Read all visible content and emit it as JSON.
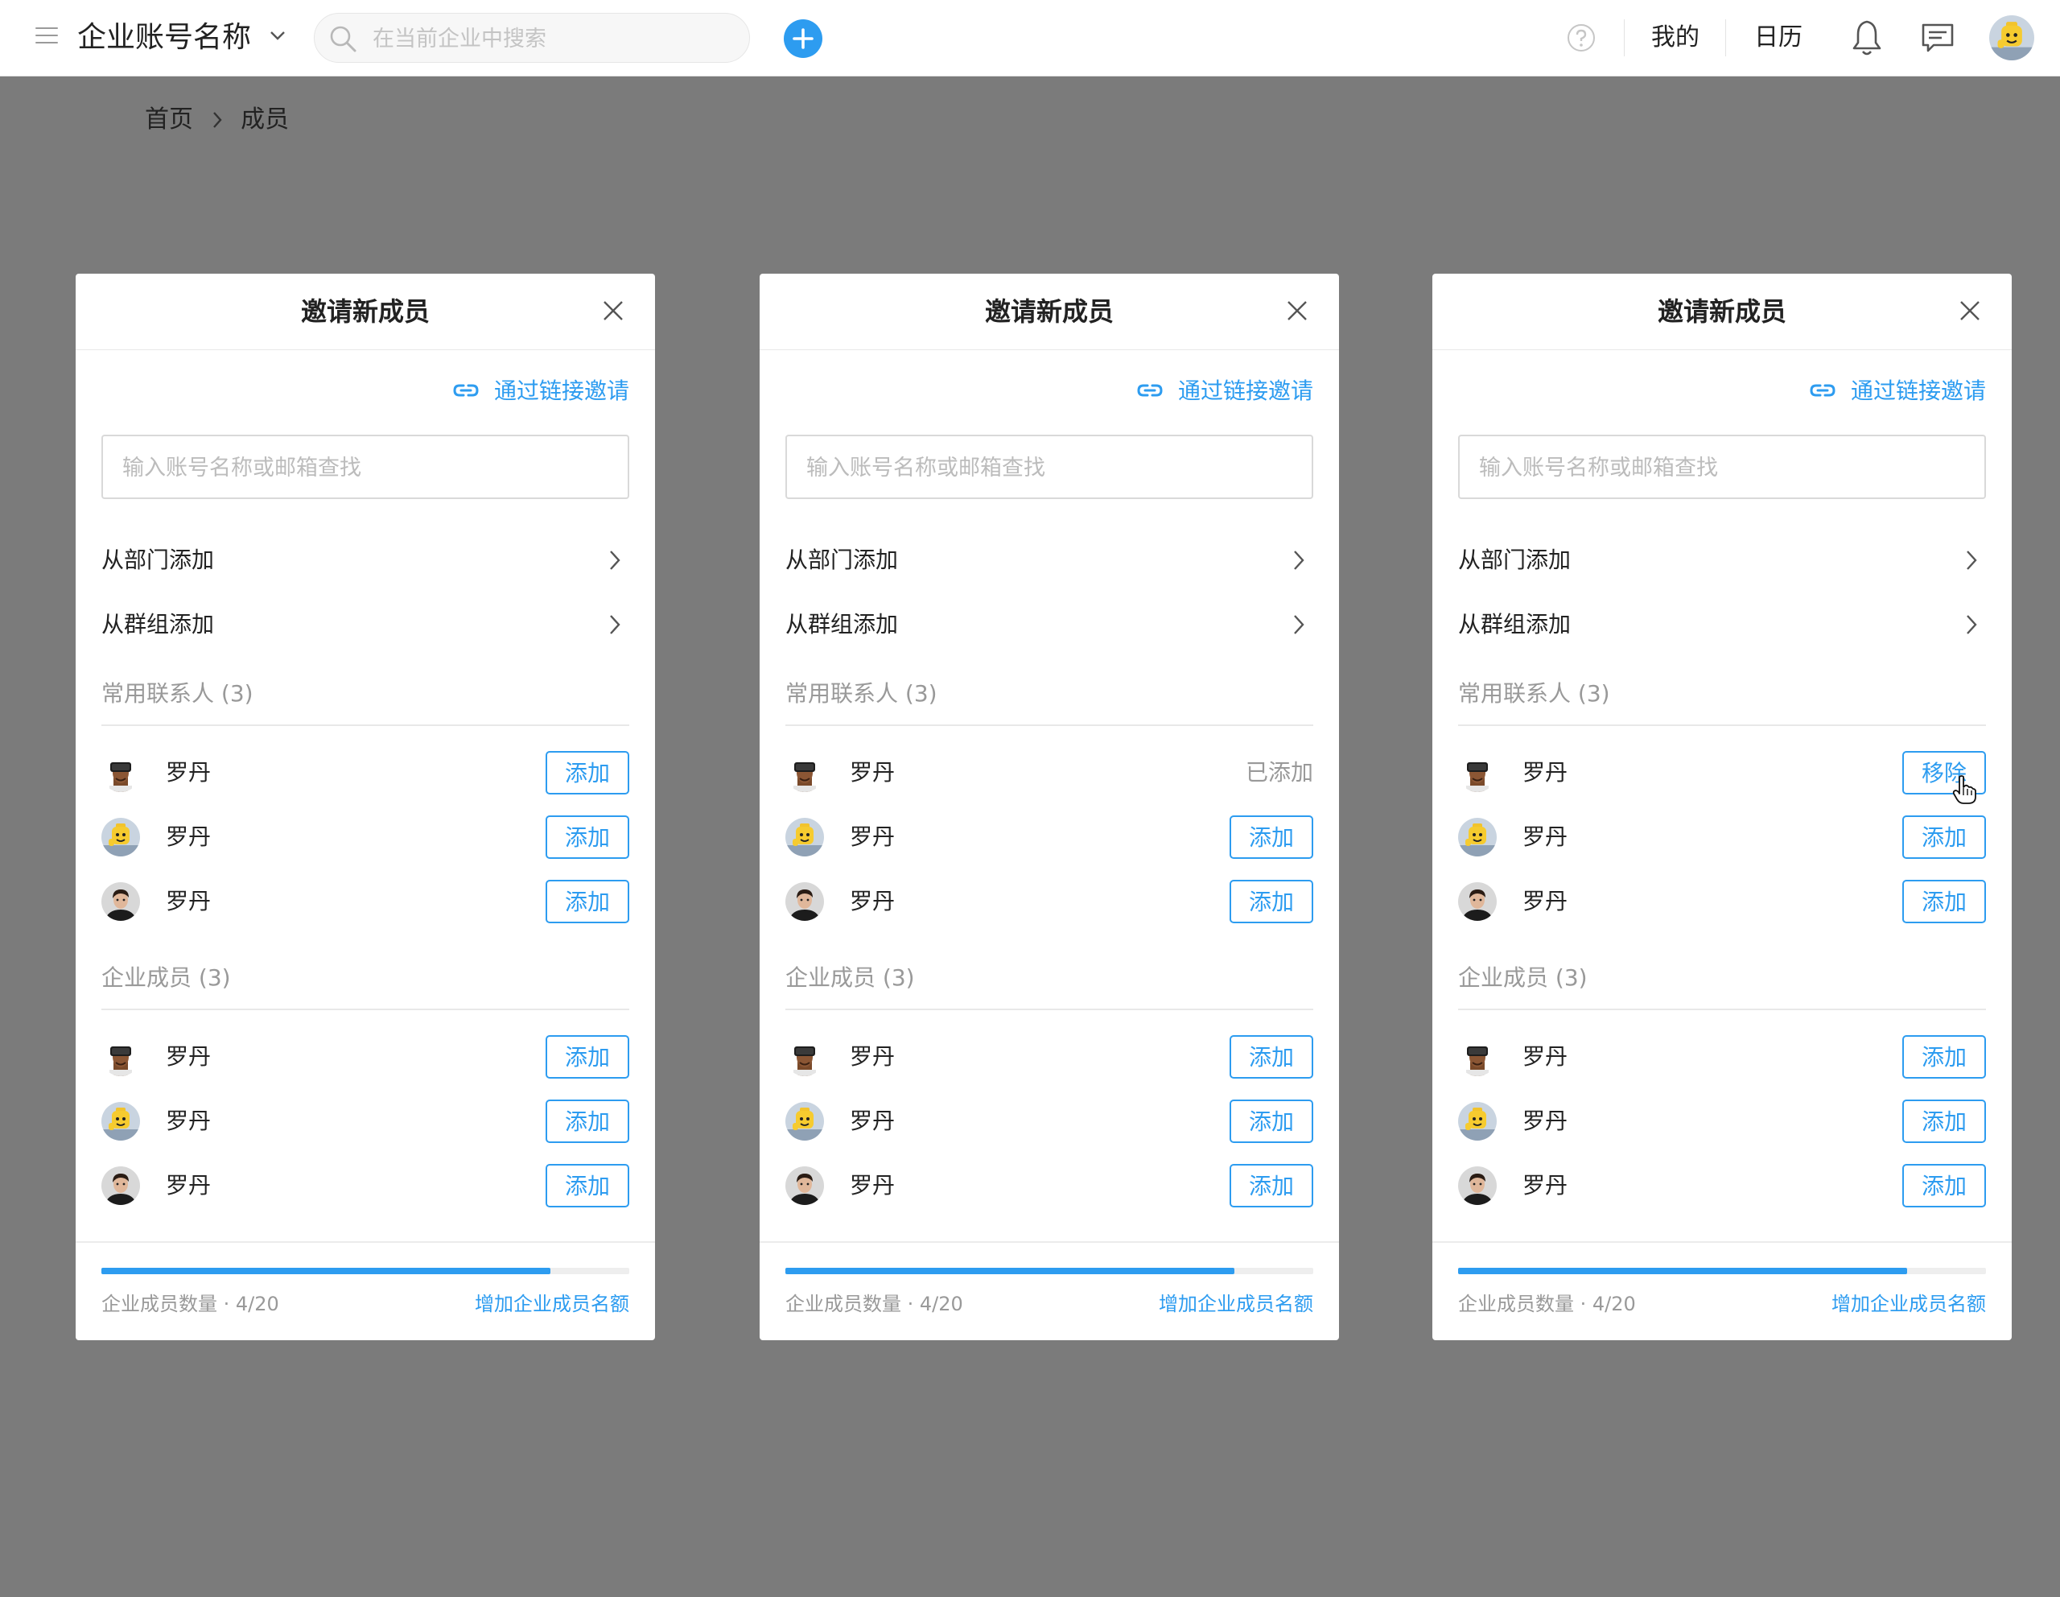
{
  "topbar": {
    "company_name": "企业账号名称",
    "search_placeholder": "在当前企业中搜索",
    "nav_mine": "我的",
    "nav_calendar": "日历"
  },
  "breadcrumb": {
    "home": "首页",
    "current": "成员"
  },
  "colors": {
    "accent": "#2d9cf0",
    "overlay": "#7b7b7b",
    "muted_text": "#999999"
  },
  "dialogs": [
    {
      "title": "邀请新成员",
      "link_invite": "通过链接邀请",
      "search_placeholder": "输入账号名称或邮箱查找",
      "from_department": "从部门添加",
      "from_group": "从群组添加",
      "frequent_title": "常用联系人 (3)",
      "frequent": [
        {
          "name": "罗丹",
          "avatar": "vr-headset-avatar",
          "action": "添加",
          "state": "button"
        },
        {
          "name": "罗丹",
          "avatar": "lego-avatar",
          "action": "添加",
          "state": "button"
        },
        {
          "name": "罗丹",
          "avatar": "man-portrait-avatar",
          "action": "添加",
          "state": "button"
        }
      ],
      "members_title": "企业成员 (3)",
      "members": [
        {
          "name": "罗丹",
          "avatar": "vr-headset-avatar",
          "action": "添加"
        },
        {
          "name": "罗丹",
          "avatar": "lego-avatar",
          "action": "添加"
        },
        {
          "name": "罗丹",
          "avatar": "man-portrait-avatar",
          "action": "添加"
        }
      ],
      "quota_label": "企业成员数量 · 4/20",
      "quota_used": 4,
      "quota_total": 20,
      "quota_progress_percent": 85,
      "increase_quota": "增加企业成员名额"
    },
    {
      "title": "邀请新成员",
      "link_invite": "通过链接邀请",
      "search_placeholder": "输入账号名称或邮箱查找",
      "from_department": "从部门添加",
      "from_group": "从群组添加",
      "frequent_title": "常用联系人 (3)",
      "frequent": [
        {
          "name": "罗丹",
          "avatar": "vr-headset-avatar",
          "action": "已添加",
          "state": "text"
        },
        {
          "name": "罗丹",
          "avatar": "lego-avatar",
          "action": "添加",
          "state": "button"
        },
        {
          "name": "罗丹",
          "avatar": "man-portrait-avatar",
          "action": "添加",
          "state": "button"
        }
      ],
      "members_title": "企业成员 (3)",
      "members": [
        {
          "name": "罗丹",
          "avatar": "vr-headset-avatar",
          "action": "添加"
        },
        {
          "name": "罗丹",
          "avatar": "lego-avatar",
          "action": "添加"
        },
        {
          "name": "罗丹",
          "avatar": "man-portrait-avatar",
          "action": "添加"
        }
      ],
      "quota_label": "企业成员数量 · 4/20",
      "quota_used": 4,
      "quota_total": 20,
      "quota_progress_percent": 85,
      "increase_quota": "增加企业成员名额"
    },
    {
      "title": "邀请新成员",
      "link_invite": "通过链接邀请",
      "search_placeholder": "输入账号名称或邮箱查找",
      "from_department": "从部门添加",
      "from_group": "从群组添加",
      "frequent_title": "常用联系人 (3)",
      "frequent": [
        {
          "name": "罗丹",
          "avatar": "vr-headset-avatar",
          "action": "移除",
          "state": "button-hover"
        },
        {
          "name": "罗丹",
          "avatar": "lego-avatar",
          "action": "添加",
          "state": "button"
        },
        {
          "name": "罗丹",
          "avatar": "man-portrait-avatar",
          "action": "添加",
          "state": "button"
        }
      ],
      "members_title": "企业成员 (3)",
      "members": [
        {
          "name": "罗丹",
          "avatar": "vr-headset-avatar",
          "action": "添加"
        },
        {
          "name": "罗丹",
          "avatar": "lego-avatar",
          "action": "添加"
        },
        {
          "name": "罗丹",
          "avatar": "man-portrait-avatar",
          "action": "添加"
        }
      ],
      "quota_label": "企业成员数量 · 4/20",
      "quota_used": 4,
      "quota_total": 20,
      "quota_progress_percent": 85,
      "increase_quota": "增加企业成员名额"
    }
  ]
}
